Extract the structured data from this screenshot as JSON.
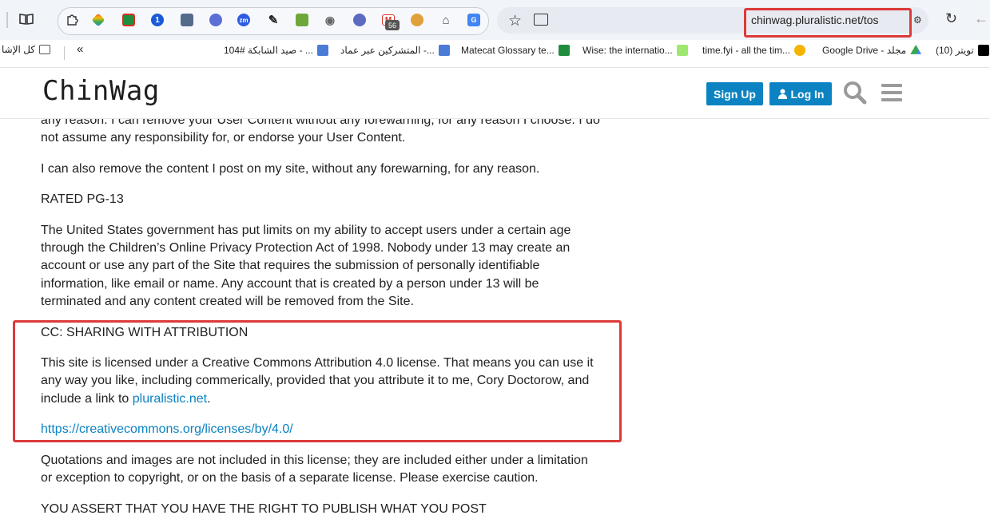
{
  "browser": {
    "url": "chinwag.pluralistic.net/tos",
    "extension_badge": "56",
    "bookmarks": [
      {
        "label": "كل الإشا",
        "color": "#555555"
      },
      {
        "label": "104# صيد الشابكة - ...",
        "color": "#4a7bd6"
      },
      {
        "label": "المتشركين عبر عماد -...",
        "color": "#4a7bd6"
      },
      {
        "label": "Matecat Glossary te...",
        "color": "#1e8e3e"
      },
      {
        "label": "Wise: the internatio...",
        "color": "#163300"
      },
      {
        "label": "time.fyi - all the tim...",
        "color": "#f5b400"
      },
      {
        "label": "Google Drive - مجلد",
        "color": "#1fa463"
      },
      {
        "label": "(10) تويتر",
        "color": "#000000"
      }
    ],
    "more_bookmarks_label": "«"
  },
  "site": {
    "logo": "ChinWag",
    "signup_label": "Sign Up",
    "login_label": "Log In"
  },
  "content": {
    "para_partial": "any reason. I can remove your User Content without any forewarning, for any reason I choose. I do not assume any responsibility for, or endorse your User Content.",
    "para_remove": "I can also remove the content I post on my site, without any forewarning, for any reason.",
    "heading_rated": "RATED PG-13",
    "para_rated": "The United States government has put limits on my ability to accept users under a certain age through the Children’s Online Privacy Protection Act of 1998. Nobody under 13 may create an account or use any part of the Site that requires the submission of personally identifiable information, like email or name. Any account that is created by a person under 13 will be terminated and any content created will be removed from the Site.",
    "heading_cc": "CC: SHARING WITH ATTRIBUTION",
    "para_cc_before": "This site is licensed under a Creative Commons Attribution 4.0 license. That means you can use it any way you like, including commerically, provided that you attribute it to me, Cory Doctorow, and include a link to ",
    "para_cc_link": "pluralistic.net",
    "para_cc_after": ".",
    "cc_url": "https://creativecommons.org/licenses/by/4.0/",
    "para_quotes": "Quotations and images are not included in this license; they are included either under a limitation or exception to copyright, or on the basis of a separate license. Please exercise caution.",
    "heading_assert": "YOU ASSERT THAT YOU HAVE THE RIGHT TO PUBLISH WHAT YOU POST"
  },
  "colors": {
    "accent": "#0b83c2",
    "highlight": "#dc3a3a"
  }
}
